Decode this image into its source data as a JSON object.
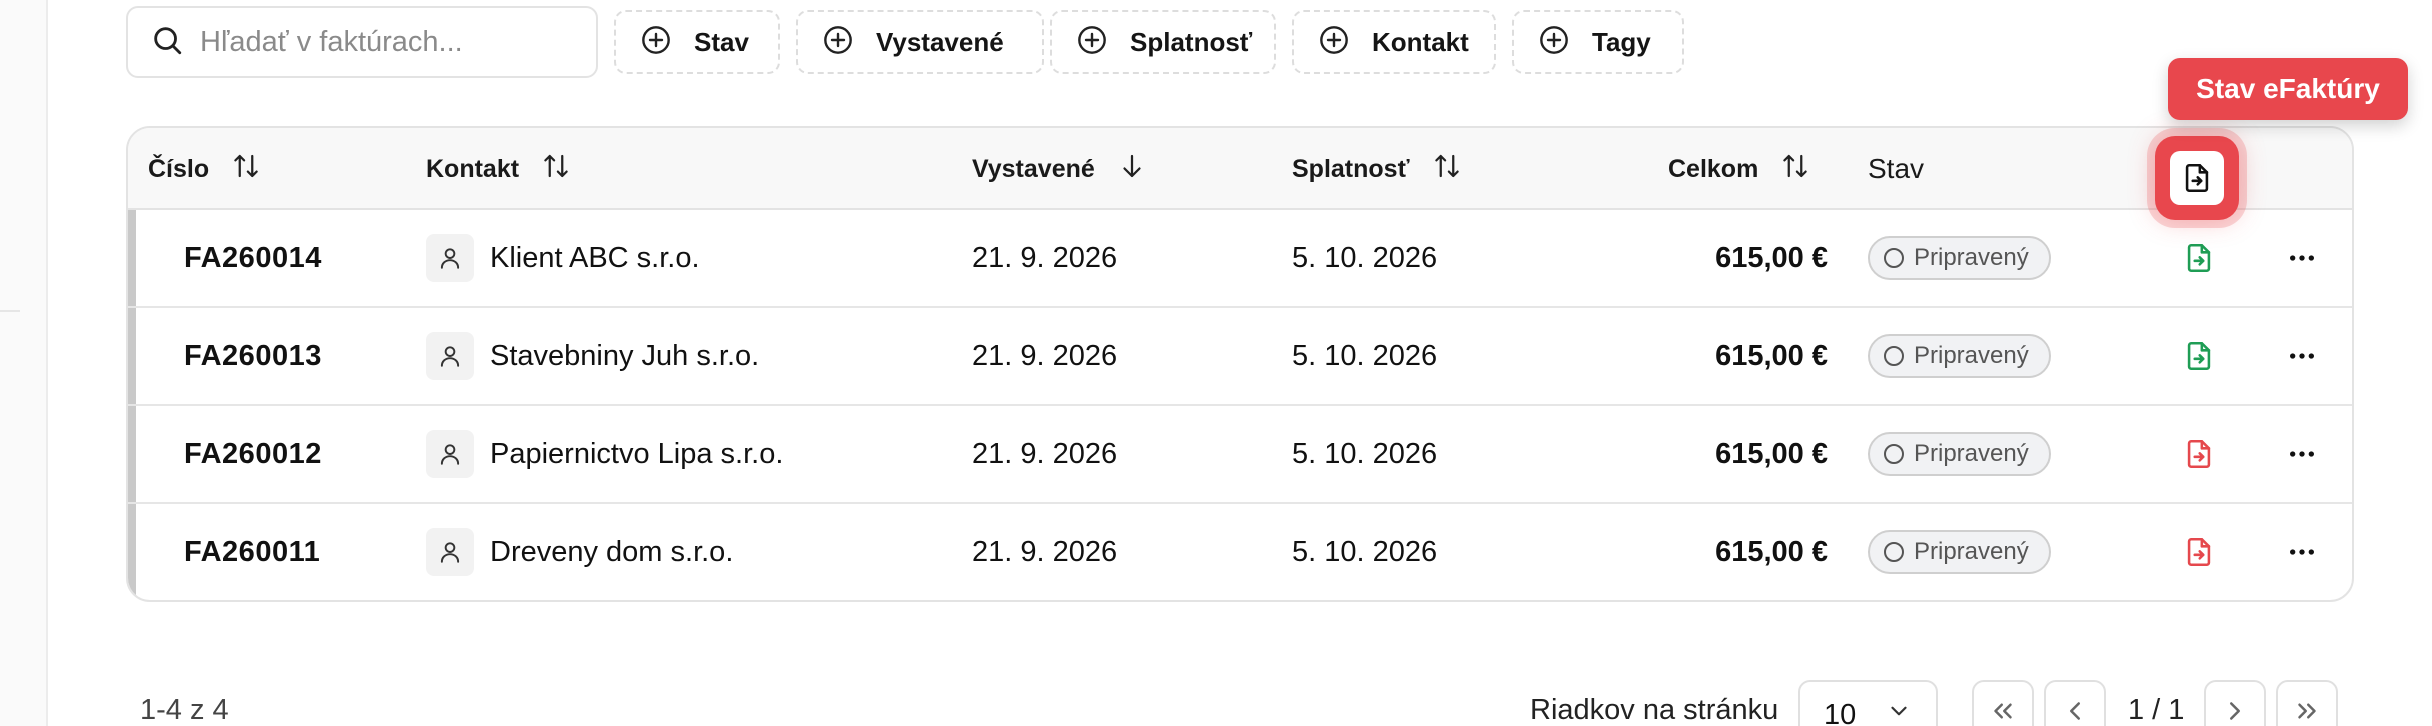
{
  "search": {
    "placeholder": "Hľadať v faktúrach..."
  },
  "filters": [
    {
      "label": "Stav",
      "name": "filter-stav-button"
    },
    {
      "label": "Vystavené",
      "name": "filter-vystavene-button"
    },
    {
      "label": "Splatnosť",
      "name": "filter-splatnost-button"
    },
    {
      "label": "Kontakt",
      "name": "filter-kontakt-button"
    },
    {
      "label": "Tagy",
      "name": "filter-tagy-button"
    }
  ],
  "table": {
    "columns": {
      "number": "Číslo",
      "contact": "Kontakt",
      "issued": "Vystavené",
      "due": "Splatnosť",
      "total": "Celkom",
      "status": "Stav"
    },
    "rows": [
      {
        "number": "FA260014",
        "contact": "Klient ABC s.r.o.",
        "issued": "21. 9. 2026",
        "due": "5. 10. 2026",
        "total": "615,00 €",
        "status": "Pripravený",
        "einvoice": "sent"
      },
      {
        "number": "FA260013",
        "contact": "Stavebniny Juh s.r.o.",
        "issued": "21. 9. 2026",
        "due": "5. 10. 2026",
        "total": "615,00 €",
        "status": "Pripravený",
        "einvoice": "sent"
      },
      {
        "number": "FA260012",
        "contact": "Papiernictvo Lipa s.r.o.",
        "issued": "21. 9. 2026",
        "due": "5. 10. 2026",
        "total": "615,00 €",
        "status": "Pripravený",
        "einvoice": "failed"
      },
      {
        "number": "FA260011",
        "contact": "Dreveny dom s.r.o.",
        "issued": "21. 9. 2026",
        "due": "5. 10. 2026",
        "total": "615,00 €",
        "status": "Pripravený",
        "einvoice": "failed"
      }
    ]
  },
  "tooltip": {
    "text": "Stav eFaktúry"
  },
  "pagination": {
    "range": "1-4 z 4",
    "rows_label": "Riadkov na stránku",
    "rows_value": "10",
    "page": "1 / 1"
  },
  "colors": {
    "accent_red": "#e8474d",
    "einvoice_ok": "#1f9d55",
    "einvoice_fail": "#e5484d"
  },
  "icons": {
    "search": "search-icon",
    "filter_add": "plus-circle-icon",
    "sort": "sort-arrows-icon",
    "sort_desc": "arrow-down-icon",
    "contact": "user-icon",
    "einvoice": "file-export-icon",
    "more": "more-horizontal-icon",
    "first": "chevrons-left-icon",
    "prev": "chevron-left-icon",
    "next": "chevron-right-icon",
    "last": "chevrons-right-icon",
    "dropdown": "chevron-down-icon"
  }
}
